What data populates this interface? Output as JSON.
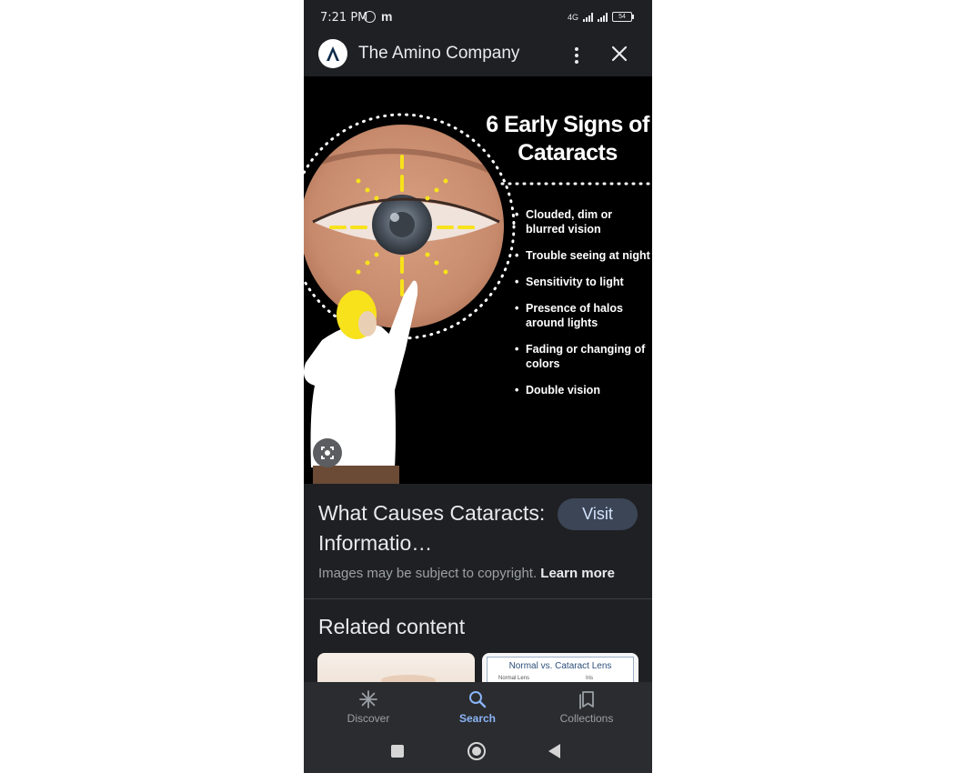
{
  "status_bar": {
    "time": "7:21 PM",
    "carrier_icon": "m",
    "battery": "54",
    "network": "4G"
  },
  "header": {
    "site_name": "The Amino Company",
    "logo_icon": "amino-logo-icon",
    "more_icon": "more-vert-icon",
    "close_icon": "close-icon"
  },
  "image": {
    "title": "6 Early Signs of Cataracts",
    "signs": [
      "Clouded, dim or blurred vision",
      "Trouble seeing at night",
      "Sensitivity to light",
      "Presence of halos around lights",
      "Fading or changing of colors",
      "Double vision"
    ],
    "lens_icon": "google-lens-icon"
  },
  "result": {
    "title": "What Causes Cataracts: Informatio…",
    "visit_label": "Visit",
    "copyright_text": "Images may be subject to copyright.",
    "learn_more": "Learn more"
  },
  "related": {
    "heading": "Related content",
    "thumb2_title": "Normal vs. Cataract Lens",
    "thumb2_left_label": "Normal Lens",
    "thumb2_right_label": "Iris"
  },
  "bottom_nav": {
    "items": [
      {
        "label": "Discover",
        "icon": "asterisk-icon"
      },
      {
        "label": "Search",
        "icon": "search-icon"
      },
      {
        "label": "Collections",
        "icon": "collections-icon"
      }
    ],
    "active_color": "#8ab4f8"
  }
}
